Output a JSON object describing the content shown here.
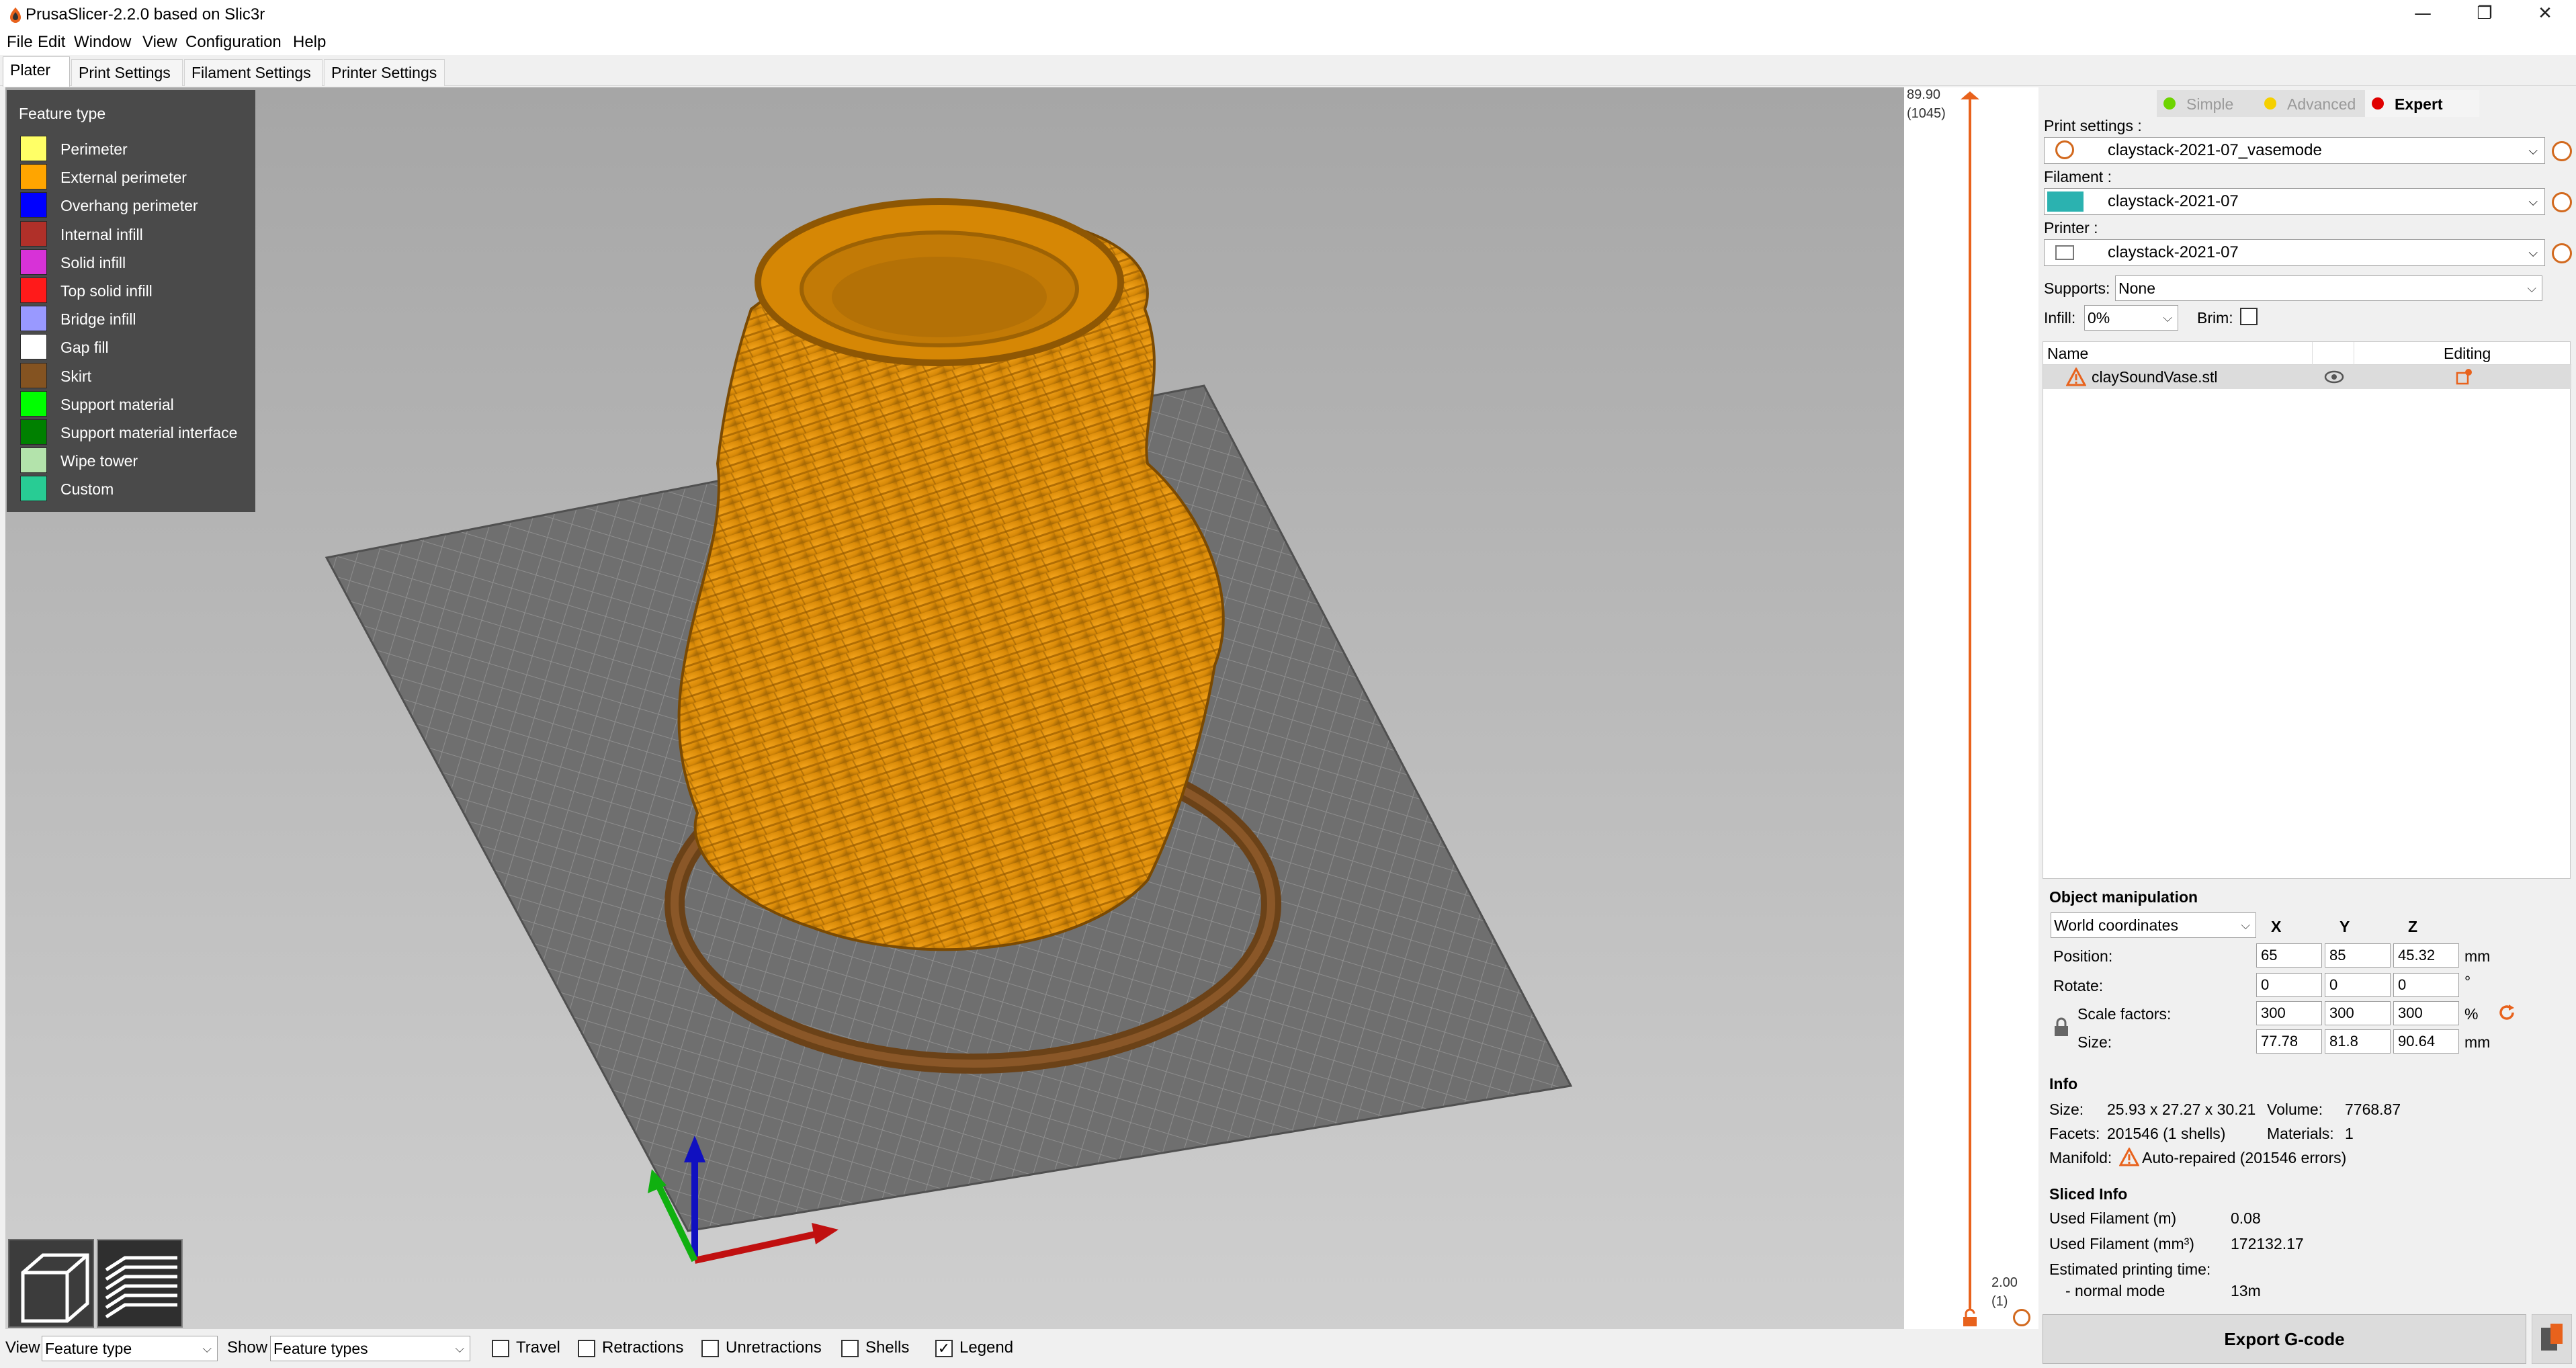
{
  "window": {
    "title": "PrusaSlicer-2.2.0 based on Slic3r",
    "minimize_glyph": "—",
    "restore_glyph": "❐",
    "close_glyph": "✕"
  },
  "menu": {
    "items": [
      "File",
      "Edit",
      "Window",
      "View",
      "Configuration",
      "Help"
    ]
  },
  "tabs": [
    "Plater",
    "Print Settings",
    "Filament Settings",
    "Printer Settings"
  ],
  "legend": {
    "title": "Feature type",
    "items": [
      {
        "label": "Perimeter",
        "color": "#ffff66"
      },
      {
        "label": "External perimeter",
        "color": "#ffa500"
      },
      {
        "label": "Overhang perimeter",
        "color": "#0000ff"
      },
      {
        "label": "Internal infill",
        "color": "#b03029"
      },
      {
        "label": "Solid infill",
        "color": "#d732d7"
      },
      {
        "label": "Top solid infill",
        "color": "#ff1a1a"
      },
      {
        "label": "Bridge infill",
        "color": "#9999ff"
      },
      {
        "label": "Gap fill",
        "color": "#ffffff"
      },
      {
        "label": "Skirt",
        "color": "#845321"
      },
      {
        "label": "Support material",
        "color": "#00ff00"
      },
      {
        "label": "Support material interface",
        "color": "#008000"
      },
      {
        "label": "Wipe tower",
        "color": "#b3e3ab"
      },
      {
        "label": "Custom",
        "color": "#28cc94"
      }
    ]
  },
  "layer_slider": {
    "top_value": "89.90",
    "top_layer": "(1045)",
    "bottom_value": "2.00",
    "bottom_layer": "(1)"
  },
  "bottom_bar": {
    "view_label": "View",
    "view_value": "Feature type",
    "show_label": "Show",
    "show_value": "Feature types",
    "checkboxes": [
      {
        "label": "Travel",
        "checked": false
      },
      {
        "label": "Retractions",
        "checked": false
      },
      {
        "label": "Unretractions",
        "checked": false
      },
      {
        "label": "Shells",
        "checked": false
      },
      {
        "label": "Legend",
        "checked": true
      }
    ],
    "check_glyph": "✓"
  },
  "modes": [
    {
      "label": "Simple",
      "color": "#6dd400",
      "active": false
    },
    {
      "label": "Advanced",
      "color": "#f5d000",
      "active": false
    },
    {
      "label": "Expert",
      "color": "#e00000",
      "active": true
    }
  ],
  "print_settings": {
    "label": "Print settings :",
    "value": "claystack-2021-07_vasemode"
  },
  "filament": {
    "label": "Filament :",
    "value": "claystack-2021-07",
    "color": "#2bb2b0"
  },
  "printer": {
    "label": "Printer :",
    "value": "claystack-2021-07"
  },
  "supports": {
    "label": "Supports:",
    "value": "None"
  },
  "infill": {
    "label": "Infill:",
    "value": "0%"
  },
  "brim": {
    "label": "Brim:",
    "checked": false
  },
  "object_list": {
    "headers": {
      "name": "Name",
      "editing": "Editing"
    },
    "rows": [
      {
        "name": "claySoundVase.stl",
        "warning": true
      }
    ]
  },
  "object_manipulation": {
    "title": "Object manipulation",
    "coord_system": "World coordinates",
    "axes": [
      "X",
      "Y",
      "Z"
    ],
    "position": {
      "label": "Position:",
      "values": [
        "65",
        "85",
        "45.32"
      ],
      "unit": "mm"
    },
    "rotate": {
      "label": "Rotate:",
      "values": [
        "0",
        "0",
        "0"
      ],
      "unit": "°"
    },
    "scale": {
      "label": "Scale factors:",
      "values": [
        "300",
        "300",
        "300"
      ],
      "unit": "%"
    },
    "size": {
      "label": "Size:",
      "values": [
        "77.78",
        "81.8",
        "90.64"
      ],
      "unit": "mm"
    }
  },
  "info": {
    "title": "Info",
    "size_label": "Size:",
    "size_value": "25.93 x 27.27 x 30.21",
    "volume_label": "Volume:",
    "volume_value": "7768.87",
    "facets_label": "Facets:",
    "facets_value": "201546 (1 shells)",
    "materials_label": "Materials:",
    "materials_value": "1",
    "manifold_label": "Manifold:",
    "manifold_value": "Auto-repaired (201546 errors)"
  },
  "sliced_info": {
    "title": "Sliced Info",
    "used_m_label": "Used Filament (m)",
    "used_m_value": "0.08",
    "used_mm3_label": "Used Filament (mm³)",
    "used_mm3_value": "172132.17",
    "time_label": "Estimated printing time:",
    "mode_label": "- normal mode",
    "mode_value": "13m"
  },
  "export_button": "Export G-code"
}
